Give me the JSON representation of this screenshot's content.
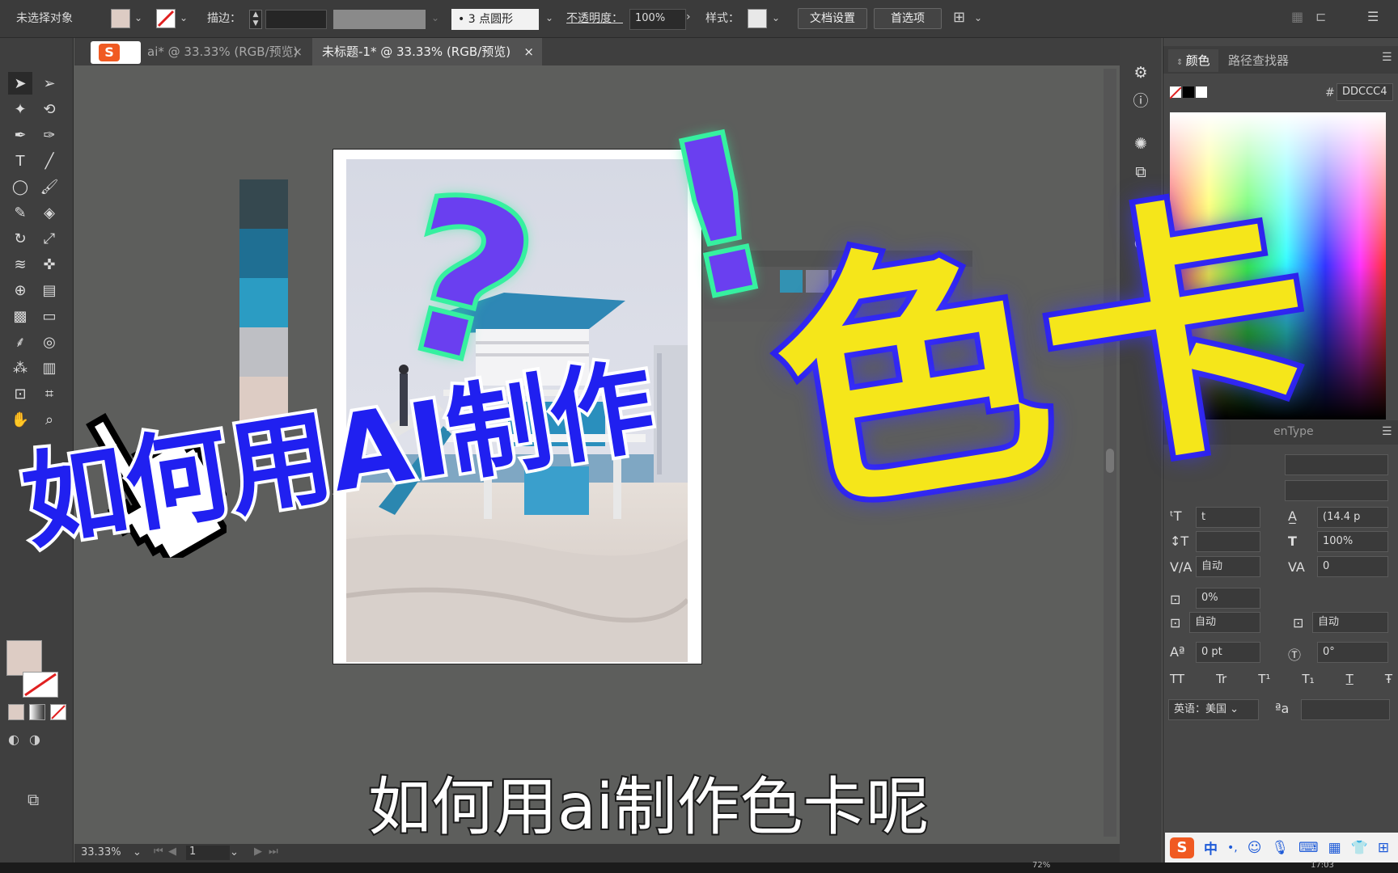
{
  "control_bar": {
    "selection_label": "未选择对象",
    "stroke_label": "描边：",
    "brush_value": "3 点圆形",
    "opacity_label": "不透明度：",
    "opacity_value": "100%",
    "style_label": "样式：",
    "doc_settings_button": "文档设置",
    "preferences_button": "首选项"
  },
  "tabs": [
    {
      "label": "ai* @ 33.33% (RGB/预览)",
      "close": "×",
      "active": false
    },
    {
      "label": "未标题-1* @ 33.33% (RGB/预览)",
      "close": "×",
      "active": true
    }
  ],
  "swatches_column": [
    "#35484f",
    "#1f6f93",
    "#2b9cc3",
    "#bebfc4",
    "#ddccc4"
  ],
  "floating_swatches": [
    "#2b9cc3",
    "#8c8ca6",
    "#b7adc6",
    "#c7b8c6",
    "#c5c3cf"
  ],
  "overlay": {
    "headline": "如何用AI制作",
    "big_title": "色卡",
    "question_mark": "?",
    "exclamation": "!",
    "subtitle": "如何用ai制作色卡呢"
  },
  "color_panel": {
    "tab_color": "颜色",
    "tab_pathfinder": "路径查找器",
    "hex_prefix": "#",
    "hex_value": "DDCCC4",
    "current_fill": "#ddccc4"
  },
  "char_panel": {
    "tab_fragment": "enType",
    "leading_value": "(14.4 p",
    "vscale_value": "100%",
    "kerning_value": "自动",
    "tracking_value": "0",
    "tsume_value": "0%",
    "aki_left": "自动",
    "aki_right": "自动",
    "baseline_value": "0 pt",
    "rotation_value": "0°",
    "language_value": "英语：美国",
    "type_buttons": [
      "TT",
      "Tr",
      "T¹",
      "T₁",
      "T",
      "Ŧ"
    ]
  },
  "status_bar": {
    "zoom": "33.33%",
    "page": "1",
    "taskbar_percent": "72%",
    "time": "17:03"
  },
  "ime_bar": {
    "logo": "S",
    "mode": "中",
    "punct": "•,"
  },
  "accent_colors": {
    "headline_blue": "#2020f0",
    "title_yellow": "#f5e61a",
    "symbol_purple": "#6a3ff0",
    "symbol_glow": "#37f0a0"
  }
}
